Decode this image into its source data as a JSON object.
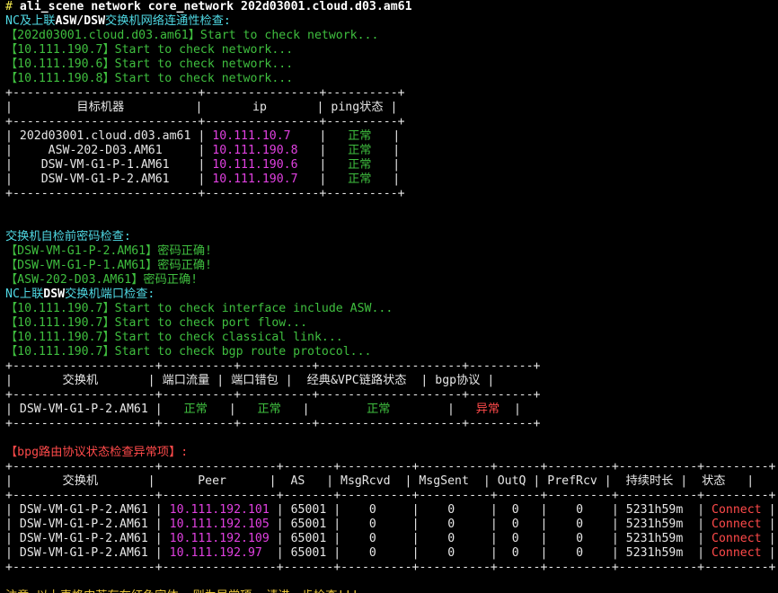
{
  "colors": {
    "background": "#000000",
    "default": "#e6e6e6",
    "yellow": "#f2e94e",
    "cyan": "#4fd8e3",
    "green": "#3fbf3f",
    "magenta": "#e040e0",
    "red": "#ff4a4a",
    "orange": "#e6c23a"
  },
  "lines": [
    [
      [
        "# ",
        "yellow"
      ],
      [
        "ali_scene network core_network 202d03001.cloud.d03.am61",
        "bold"
      ]
    ],
    [
      [
        "NC及上联",
        "cyan"
      ],
      [
        "ASW/DSW",
        "bright"
      ],
      [
        "交换机网络连通性检查:",
        "cyan"
      ]
    ],
    [
      [
        "【202d03001.cloud.d03.am61】Start to check network...",
        "green"
      ]
    ],
    [
      [
        "【10.111.190.7】Start to check network...",
        "green"
      ]
    ],
    [
      [
        "【10.111.190.6】Start to check network...",
        "green"
      ]
    ],
    [
      [
        "【10.111.190.8】Start to check network...",
        "green"
      ]
    ],
    [
      [
        "+--------------------------+----------------+----------+",
        "white"
      ]
    ],
    [
      [
        "|         目标机器          |       ip       | ping状态 |",
        "white"
      ]
    ],
    [
      [
        "+--------------------------+----------------+----------+",
        "white"
      ]
    ],
    [
      [
        "| 202d03001.cloud.d03.am61 | ",
        "white"
      ],
      [
        "10.111.10.7",
        "magenta"
      ],
      [
        "    |   ",
        "white"
      ],
      [
        "正常",
        "green"
      ],
      [
        "   |",
        "white"
      ]
    ],
    [
      [
        "|     ASW-202-D03.AM61     | ",
        "white"
      ],
      [
        "10.111.190.8",
        "magenta"
      ],
      [
        "   |   ",
        "white"
      ],
      [
        "正常",
        "green"
      ],
      [
        "   |",
        "white"
      ]
    ],
    [
      [
        "|    DSW-VM-G1-P-1.AM61    | ",
        "white"
      ],
      [
        "10.111.190.6",
        "magenta"
      ],
      [
        "   |   ",
        "white"
      ],
      [
        "正常",
        "green"
      ],
      [
        "   |",
        "white"
      ]
    ],
    [
      [
        "|    DSW-VM-G1-P-2.AM61    | ",
        "white"
      ],
      [
        "10.111.190.7",
        "magenta"
      ],
      [
        "   |   ",
        "white"
      ],
      [
        "正常",
        "green"
      ],
      [
        "   |",
        "white"
      ]
    ],
    [
      [
        "+--------------------------+----------------+----------+",
        "white"
      ]
    ],
    [
      [
        "",
        "white"
      ]
    ],
    [
      [
        "",
        "white"
      ]
    ],
    [
      [
        "交换机自检前密码检查:",
        "cyan"
      ]
    ],
    [
      [
        "【DSW-VM-G1-P-2.AM61】密码正确!",
        "green"
      ]
    ],
    [
      [
        "【DSW-VM-G1-P-1.AM61】密码正确!",
        "green"
      ]
    ],
    [
      [
        "【ASW-202-D03.AM61】密码正确!",
        "green"
      ]
    ],
    [
      [
        "NC上联",
        "cyan"
      ],
      [
        "DSW",
        "bright"
      ],
      [
        "交换机端口检查:",
        "cyan"
      ]
    ],
    [
      [
        "【10.111.190.7】Start to check interface include ASW...",
        "green"
      ]
    ],
    [
      [
        "【10.111.190.7】Start to check port flow...",
        "green"
      ]
    ],
    [
      [
        "【10.111.190.7】Start to check classical link...",
        "green"
      ]
    ],
    [
      [
        "【10.111.190.7】Start to check bgp route protocol...",
        "green"
      ]
    ],
    [
      [
        "+--------------------+----------+----------+--------------------+---------+",
        "white"
      ]
    ],
    [
      [
        "|       交换机       | 端口流量 | 端口错包 |  经典&VPC链路状态  | bgp协议 |",
        "white"
      ]
    ],
    [
      [
        "+--------------------+----------+----------+--------------------+---------+",
        "white"
      ]
    ],
    [
      [
        "| DSW-VM-G1-P-2.AM61 |   ",
        "white"
      ],
      [
        "正常",
        "green"
      ],
      [
        "   |   ",
        "white"
      ],
      [
        "正常",
        "green"
      ],
      [
        "   |        ",
        "white"
      ],
      [
        "正常",
        "green"
      ],
      [
        "        |   ",
        "white"
      ],
      [
        "异常",
        "red"
      ],
      [
        "  |",
        "white"
      ]
    ],
    [
      [
        "+--------------------+----------+----------+--------------------+---------+",
        "white"
      ]
    ],
    [
      [
        "",
        "white"
      ]
    ],
    [
      [
        "【bpg路由协议状态检查异常项】:",
        "red"
      ]
    ],
    [
      [
        "+--------------------+----------------+-------+----------+----------+------+---------+-----------+---------+",
        "white"
      ]
    ],
    [
      [
        "|       交换机       |      Peer      |  AS   | MsgRcvd  | MsgSent  | OutQ | PrefRcv |  持续时长 |  状态   |",
        "white"
      ]
    ],
    [
      [
        "+--------------------+----------------+-------+----------+----------+------+---------+-----------+---------+",
        "white"
      ]
    ],
    [
      [
        "| DSW-VM-G1-P-2.AM61 | ",
        "white"
      ],
      [
        "10.111.192.101",
        "magenta"
      ],
      [
        " | 65001 |    0     |    0     |  0   |    0    | 5231h59m  | ",
        "white"
      ],
      [
        "Connect",
        "red"
      ],
      [
        " |",
        "white"
      ]
    ],
    [
      [
        "| DSW-VM-G1-P-2.AM61 | ",
        "white"
      ],
      [
        "10.111.192.105",
        "magenta"
      ],
      [
        " | 65001 |    0     |    0     |  0   |    0    | 5231h59m  | ",
        "white"
      ],
      [
        "Connect",
        "red"
      ],
      [
        " |",
        "white"
      ]
    ],
    [
      [
        "| DSW-VM-G1-P-2.AM61 | ",
        "white"
      ],
      [
        "10.111.192.109",
        "magenta"
      ],
      [
        " | 65001 |    0     |    0     |  0   |    0    | 5231h59m  | ",
        "white"
      ],
      [
        "Connect",
        "red"
      ],
      [
        " |",
        "white"
      ]
    ],
    [
      [
        "| DSW-VM-G1-P-2.AM61 | ",
        "white"
      ],
      [
        "10.111.192.97",
        "magenta"
      ],
      [
        "  | 65001 |    0     |    0     |  0   |    0    | 5231h59m  | ",
        "white"
      ],
      [
        "Connect",
        "red"
      ],
      [
        " |",
        "white"
      ]
    ],
    [
      [
        "+--------------------+----------------+-------+----------+----------+------+---------+-----------+---------+",
        "white"
      ]
    ],
    [
      [
        "",
        "white"
      ]
    ],
    [
      [
        "注意:以上表格中若存在红色字体, 则为异常项, 请进一步检查!!!",
        "orange"
      ]
    ]
  ]
}
